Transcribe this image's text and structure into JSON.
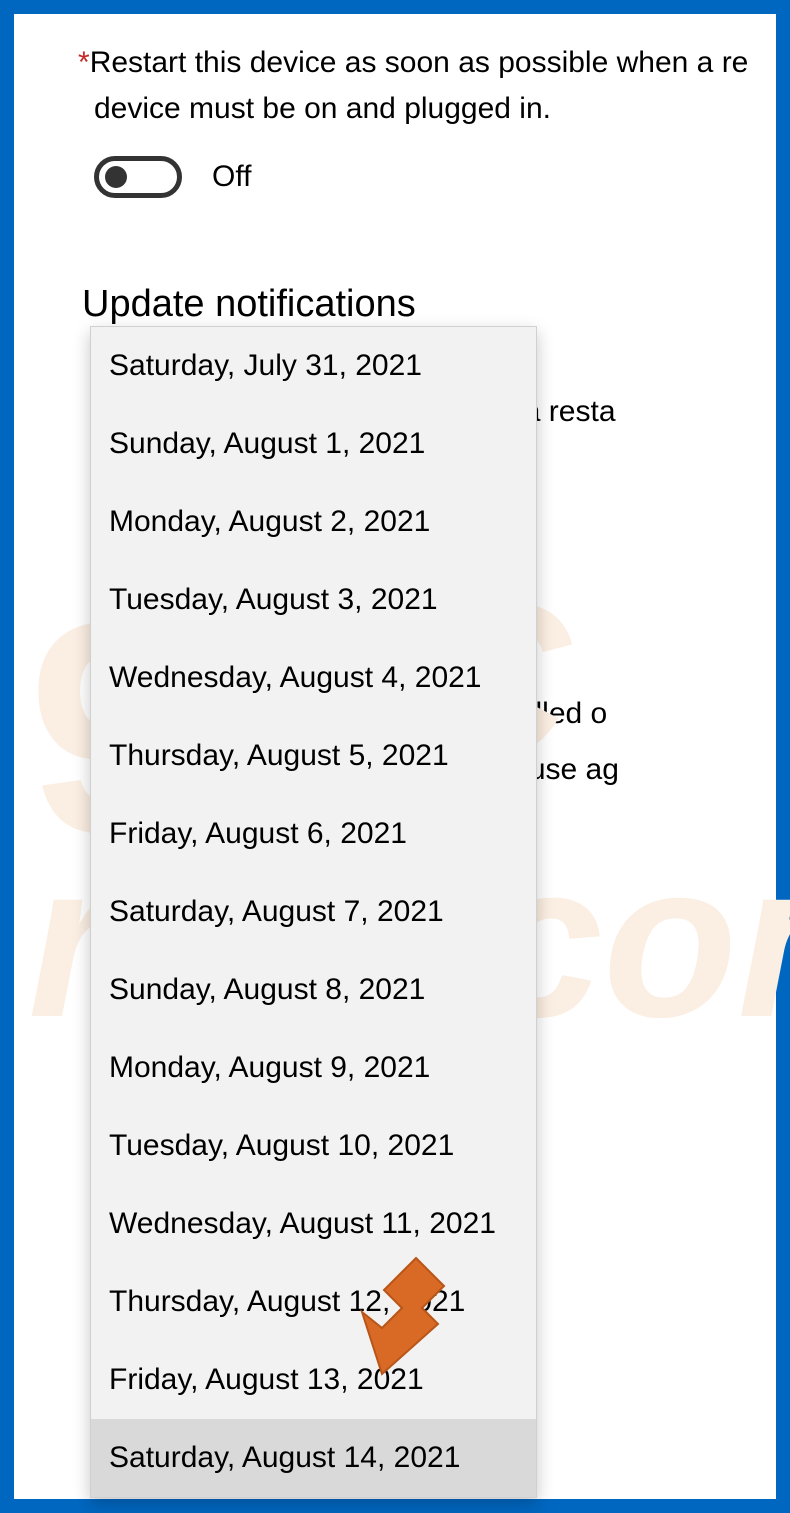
{
  "restart_option": {
    "asterisk": "*",
    "line1": "Restart this device as soon as possible when a re",
    "line2": "device must be on and plugged in.",
    "toggle_state": "Off"
  },
  "sections": {
    "heading": "Update notifications",
    "bg_text1": "PC requires a resta",
    "bg_text2": "being installed o",
    "bg_text3": "you can pause ag"
  },
  "dropdown": {
    "items": [
      "Saturday, July 31, 2021",
      "Sunday, August 1, 2021",
      "Monday, August 2, 2021",
      "Tuesday, August 3, 2021",
      "Wednesday, August 4, 2021",
      "Thursday, August 5, 2021",
      "Friday, August 6, 2021",
      "Saturday, August 7, 2021",
      "Sunday, August 8, 2021",
      "Monday, August 9, 2021",
      "Tuesday, August 10, 2021",
      "Wednesday, August 11, 2021",
      "Thursday, August 12, 2021",
      "Friday, August 13, 2021",
      "Saturday, August 14, 2021"
    ],
    "highlighted_index": 14
  },
  "watermark": {
    "nine": "9",
    "pc": "PC",
    "risk": "risk.com"
  }
}
